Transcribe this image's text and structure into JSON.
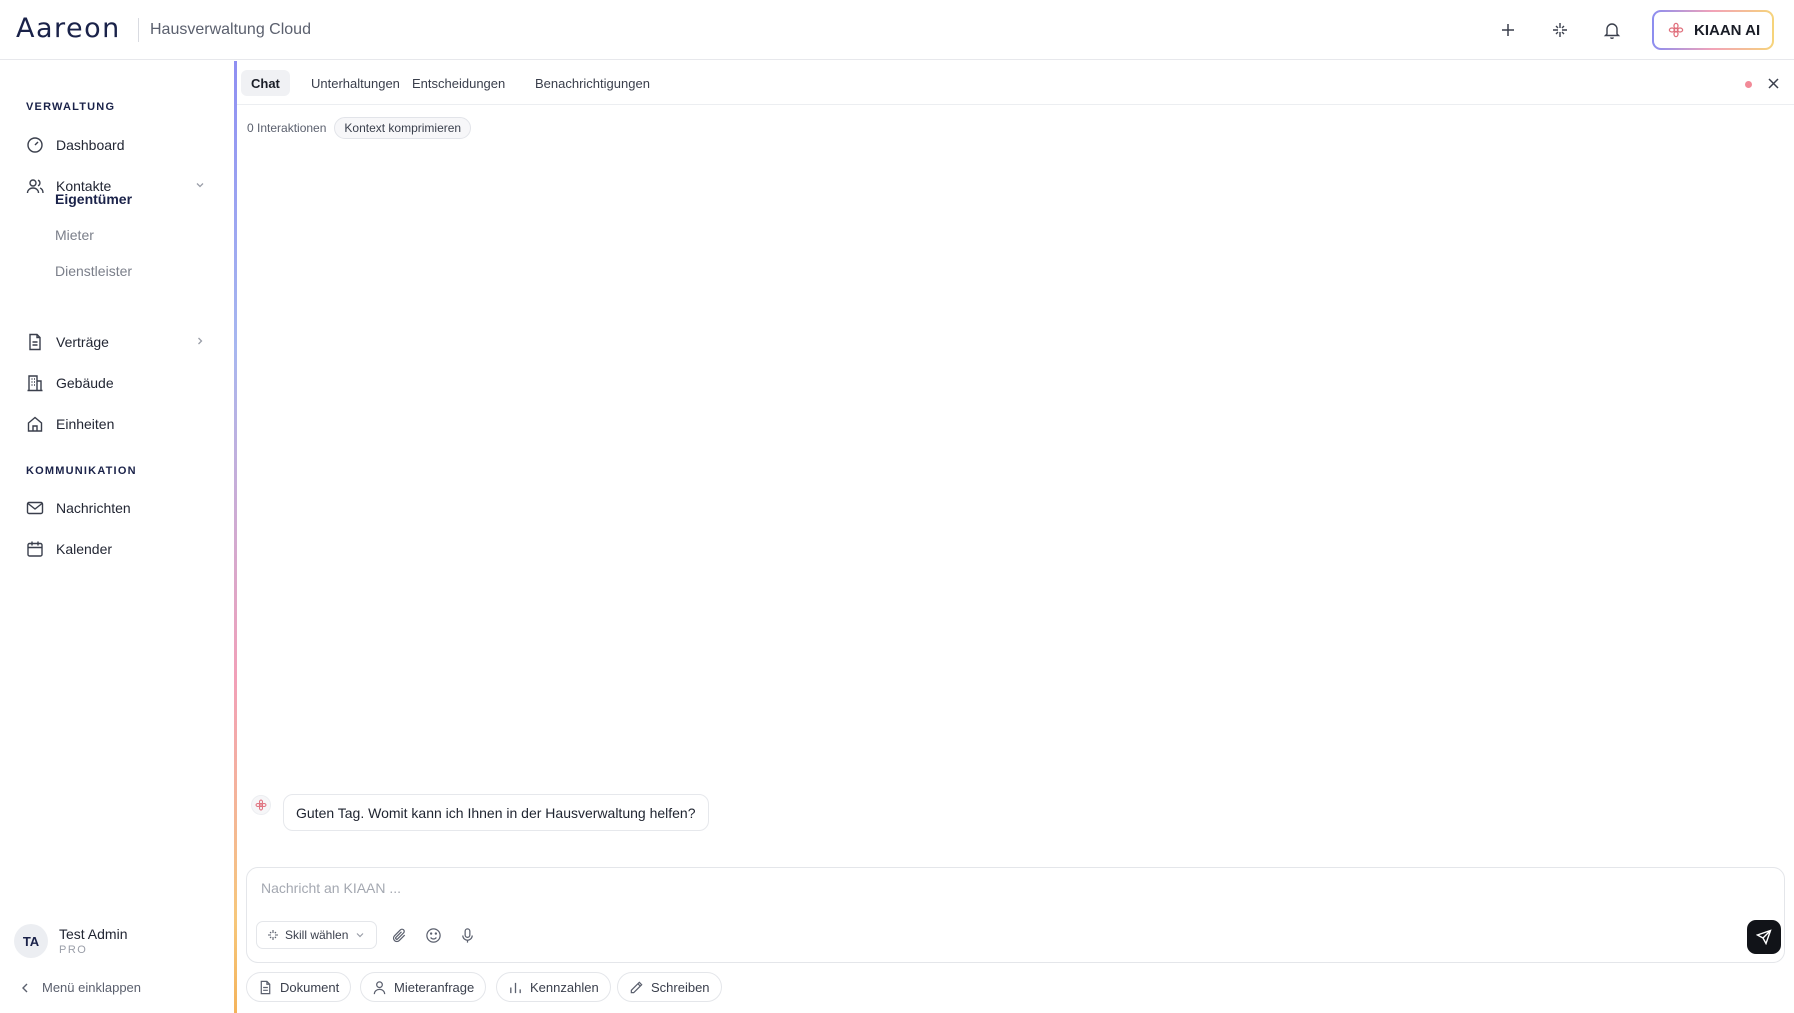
{
  "header": {
    "logo": "Aareon",
    "app_name": "Hausverwaltung Cloud",
    "icons": [
      "plus-icon",
      "sparkle-icon",
      "bell-icon"
    ],
    "kiaan_label": "KIAAN AI"
  },
  "sidebar": {
    "section_verwaltung": "VERWALTUNG",
    "section_kommunikation": "KOMMUNIKATION",
    "items": {
      "dashboard": "Dashboard",
      "kontakte": "Kontakte",
      "eigentuemer": "Eigentümer",
      "mieter": "Mieter",
      "dienstleister": "Dienstleister",
      "vertraege": "Verträge",
      "gebaeude": "Gebäude",
      "einheiten": "Einheiten",
      "nachrichten": "Nachrichten",
      "kalender": "Kalender"
    },
    "user": {
      "initials": "TA",
      "name": "Test Admin",
      "role": "PRO"
    },
    "collapse_label": "Menü einklappen"
  },
  "main": {
    "tabs": [
      "Chat",
      "Unterhaltungen",
      "Entscheidungen",
      "Benachrichtigungen"
    ],
    "interactions": "0 Interaktionen",
    "compress_label": "Kontext komprimieren",
    "message": "Guten Tag. Womit kann ich Ihnen in der Hausverwaltung helfen?",
    "composer": {
      "placeholder": "Nachricht an KIAAN ...",
      "skill_label": "Skill wählen"
    },
    "quick_actions": [
      "Dokument",
      "Mieteranfrage",
      "Kennzahlen",
      "Schreiben"
    ]
  },
  "colors": {
    "brand": "#1a2249",
    "status_dot": "#f28a98",
    "send": "#111318"
  }
}
